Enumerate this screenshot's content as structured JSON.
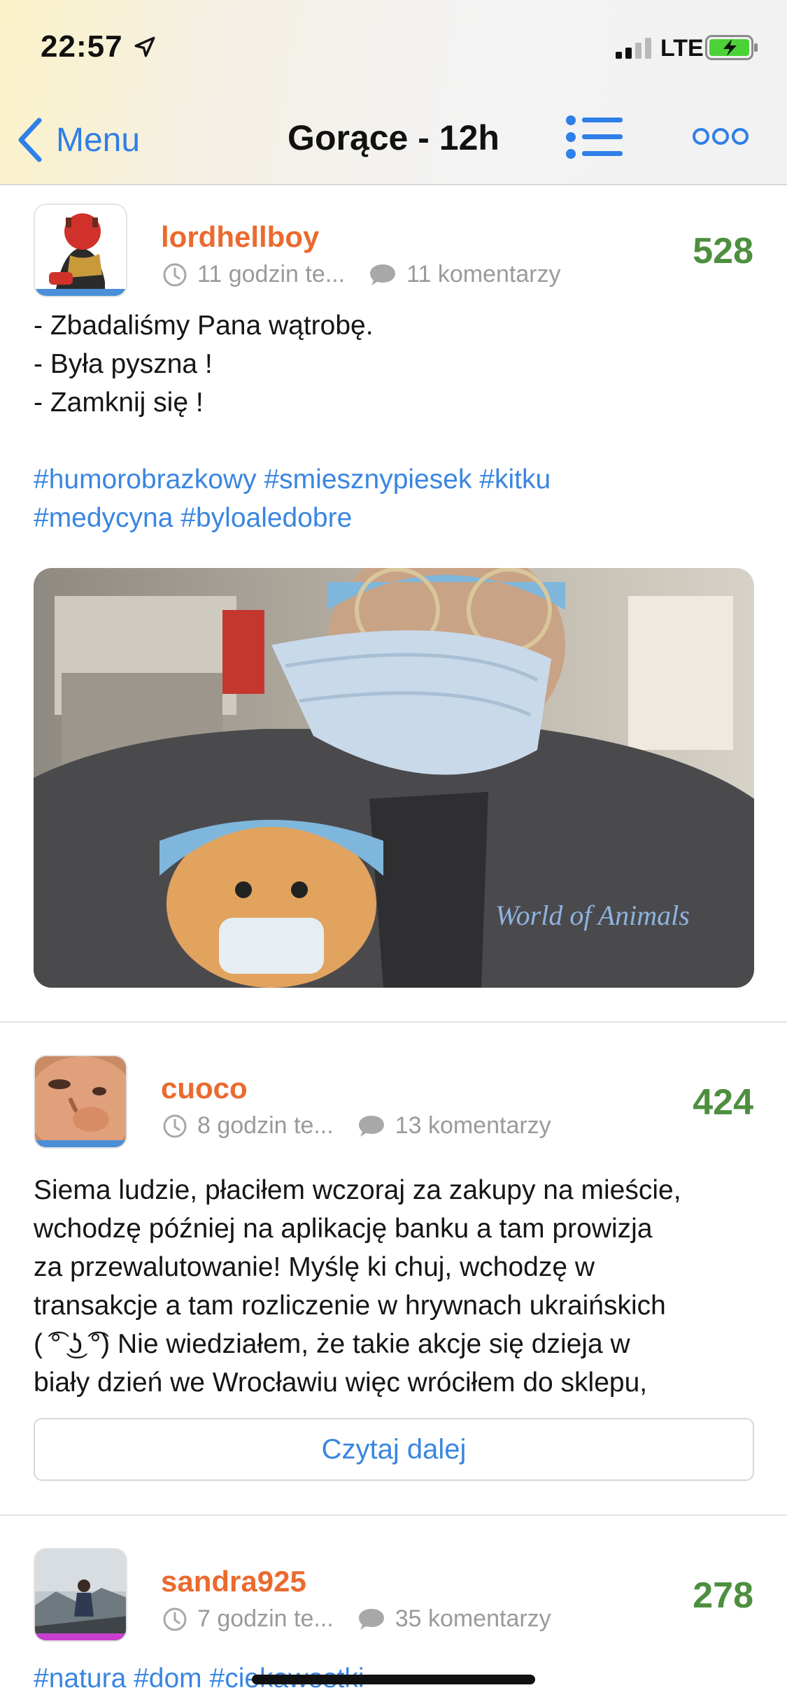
{
  "status_bar": {
    "time": "22:57",
    "network": "LTE"
  },
  "nav": {
    "back_label": "Menu",
    "title": "Gorące - 12h"
  },
  "posts": [
    {
      "username": "lordhellboy",
      "time": "11 godzin te...",
      "comments": "11 komentarzy",
      "score": "528",
      "lines": [
        "- Zbadaliśmy Pana wątrobę.",
        "- Była pyszna !",
        "- Zamknij się !"
      ],
      "tags": [
        "#humorobrazkowy #smiesznypiesek #kitku",
        "#medycyna #byloaledobre"
      ],
      "image_text": "World of Animals",
      "accent": "#4a8fd8"
    },
    {
      "username": "cuoco",
      "time": "8 godzin te...",
      "comments": "13 komentarzy",
      "score": "424",
      "lines": [
        "Siema ludzie, płaciłem wczoraj za zakupy na mieście,",
        "wchodzę później na aplikację banku a tam prowizja",
        "za przewalutowanie! Myślę ki chuj, wchodzę w",
        "transakcje a tam rozliczenie w hrywnach ukraińskich",
        "( ͡° ͜ʖ ͡°) Nie wiedziałem, że takie akcje się dzieja w",
        "biały dzień we Wrocławiu więc wróciłem do sklepu,"
      ],
      "read_more": "Czytaj dalej",
      "accent": "#4a8fd8"
    },
    {
      "username": "sandra925",
      "time": "7 godzin te...",
      "comments": "35 komentarzy",
      "score": "278",
      "tags": [
        "#natura #dom #ciekawostki"
      ],
      "accent": "#c83fcf"
    }
  ],
  "colors": {
    "accent_blue": "#2f7fe8",
    "username_orange": "#ea6a2f",
    "score_green": "#4d8f3f",
    "tag_blue": "#3a86e0"
  }
}
